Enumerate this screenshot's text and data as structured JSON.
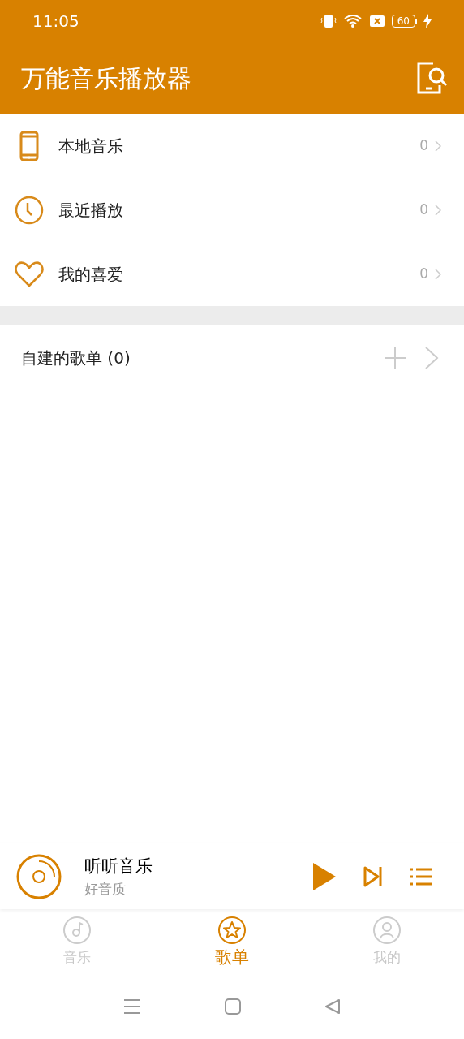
{
  "status_bar": {
    "time": "11:05",
    "battery": "60"
  },
  "header": {
    "title": "万能音乐播放器"
  },
  "library": [
    {
      "kind": "phone",
      "label": "本地音乐",
      "count": "0"
    },
    {
      "kind": "clock",
      "label": "最近播放",
      "count": "0"
    },
    {
      "kind": "heart",
      "label": "我的喜爱",
      "count": "0"
    }
  ],
  "playlists": {
    "label": "自建的歌单 (0)"
  },
  "player": {
    "title": "听听音乐",
    "subtitle": "好音质"
  },
  "tabs": [
    {
      "kind": "music",
      "label": "音乐",
      "selected": false
    },
    {
      "kind": "star",
      "label": "歌单",
      "selected": true
    },
    {
      "kind": "person",
      "label": "我的",
      "selected": false
    }
  ]
}
